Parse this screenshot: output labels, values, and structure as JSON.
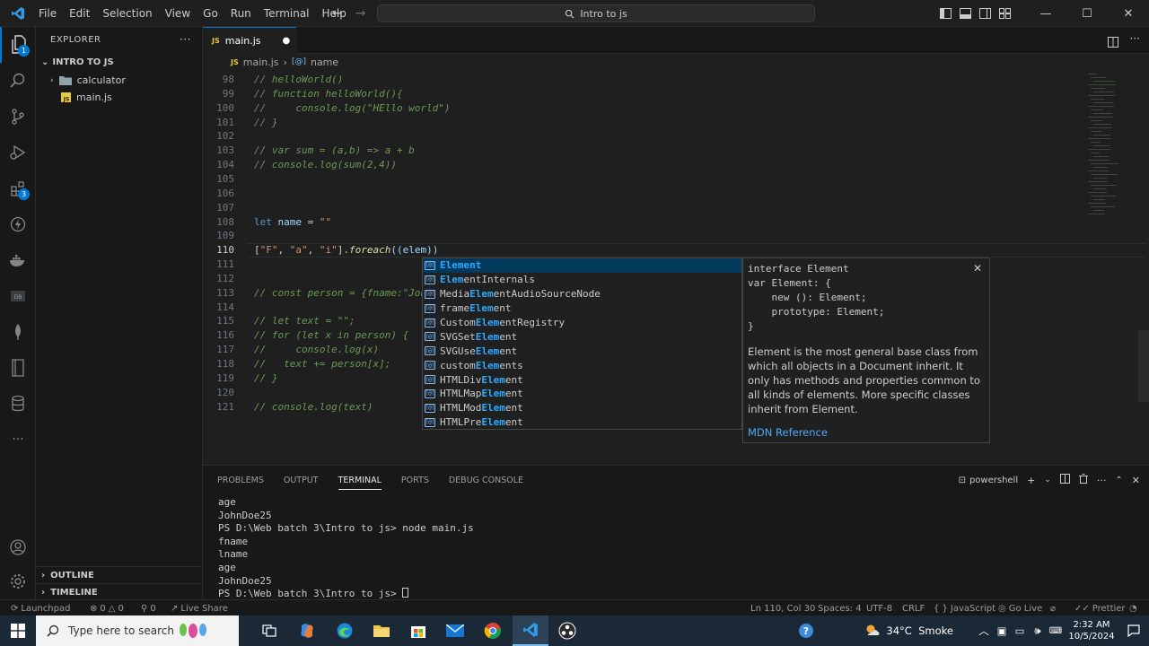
{
  "window": {
    "title": "Intro to js",
    "menu": [
      "File",
      "Edit",
      "Selection",
      "View",
      "Go",
      "Run",
      "Terminal",
      "Help"
    ]
  },
  "colors": {
    "accent": "#0078d4",
    "editor_bg": "#1f1f1f",
    "sidebar_bg": "#181818"
  },
  "sidebar": {
    "title": "EXPLORER",
    "folder": "INTRO TO JS",
    "items": [
      {
        "label": "calculator",
        "type": "folder"
      },
      {
        "label": "main.js",
        "type": "file"
      }
    ],
    "outline": "OUTLINE",
    "timeline": "TIMELINE"
  },
  "activity": {
    "explorer_badge": "1",
    "extensions_badge": "3"
  },
  "editor": {
    "tab": "main.js",
    "breadcrumb": [
      "main.js",
      "name"
    ],
    "lines": [
      {
        "n": "98",
        "text": "// helloWorld()"
      },
      {
        "n": "99",
        "text": "// function helloWorld(){"
      },
      {
        "n": "100",
        "text": "//     console.log(\"HEllo world\")"
      },
      {
        "n": "101",
        "text": "// }"
      },
      {
        "n": "102",
        "text": ""
      },
      {
        "n": "103",
        "text": "// var sum = (a,b) => a + b"
      },
      {
        "n": "104",
        "text": "// console.log(sum(2,4))"
      },
      {
        "n": "105",
        "text": ""
      },
      {
        "n": "106",
        "text": ""
      },
      {
        "n": "107",
        "text": ""
      },
      {
        "n": "108",
        "text": "let name = \"\""
      },
      {
        "n": "109",
        "text": ""
      },
      {
        "n": "110",
        "text": "[\"F\", \"a\", \"i\"].foreach((elem))"
      },
      {
        "n": "111",
        "text": ""
      },
      {
        "n": "112",
        "text": ""
      },
      {
        "n": "113",
        "text": "// const person = {fname:\"Joh"
      },
      {
        "n": "114",
        "text": ""
      },
      {
        "n": "115",
        "text": "// let text = \"\";"
      },
      {
        "n": "116",
        "text": "// for (let x in person) {"
      },
      {
        "n": "117",
        "text": "//     console.log(x)"
      },
      {
        "n": "118",
        "text": "//   text += person[x];"
      },
      {
        "n": "119",
        "text": "// }"
      },
      {
        "n": "120",
        "text": ""
      },
      {
        "n": "121",
        "text": "// console.log(text)"
      }
    ],
    "code108": {
      "kw": "let",
      "var": "name",
      "op": " = ",
      "str": "\"\""
    },
    "code110": {
      "a": "[",
      "s1": "\"F\"",
      "c1": ", ",
      "s2": "\"a\"",
      "c2": ", ",
      "s3": "\"i\"",
      "b": "].",
      "fn": "foreach",
      "rest": "((elem))"
    }
  },
  "suggest": {
    "items": [
      {
        "pre": "",
        "hl": "Element",
        "post": ""
      },
      {
        "pre": "",
        "hl": "Elem",
        "post": "entInternals"
      },
      {
        "pre": "Media",
        "hl": "Elem",
        "post": "entAudioSourceNode"
      },
      {
        "pre": "frame",
        "hl": "Elem",
        "post": "ent"
      },
      {
        "pre": "Custom",
        "hl": "Elem",
        "post": "entRegistry"
      },
      {
        "pre": "SVGSet",
        "hl": "Elem",
        "post": "ent"
      },
      {
        "pre": "SVGUse",
        "hl": "Elem",
        "post": "ent"
      },
      {
        "pre": "custom",
        "hl": "Elem",
        "post": "ents"
      },
      {
        "pre": "HTMLDiv",
        "hl": "Elem",
        "post": "ent"
      },
      {
        "pre": "HTMLMap",
        "hl": "Elem",
        "post": "ent"
      },
      {
        "pre": "HTMLMod",
        "hl": "Elem",
        "post": "ent"
      },
      {
        "pre": "HTMLPre",
        "hl": "Elem",
        "post": "ent"
      }
    ],
    "details_code": "interface Element\nvar Element: {\n    new (): Element;\n    prototype: Element;\n}",
    "details_doc": "Element is the most general base class from which all objects in a Document inherit. It only has methods and properties common to all kinds of elements. More specific classes inherit from Element.",
    "details_link": "MDN Reference"
  },
  "panel": {
    "tabs": [
      "PROBLEMS",
      "OUTPUT",
      "TERMINAL",
      "PORTS",
      "DEBUG CONSOLE"
    ],
    "active_tab": "TERMINAL",
    "shell": "powershell",
    "terminal": [
      "age",
      "JohnDoe25",
      "PS D:\\Web batch 3\\Intro to js> node main.js",
      "fname",
      "lname",
      "age",
      "JohnDoe25",
      "PS D:\\Web batch 3\\Intro to js> "
    ]
  },
  "status": {
    "launchpad": "Launchpad",
    "errors": "0",
    "warnings": "0",
    "ports": "0",
    "live_share": "Live Share",
    "position": "Ln 110, Col 30",
    "spaces": "Spaces: 4",
    "encoding": "UTF-8",
    "eol": "CRLF",
    "language": "JavaScript",
    "golive": "Go Live",
    "prettier": "Prettier"
  },
  "taskbar": {
    "search_placeholder": "Type here to search",
    "weather": "34°C  Smoke",
    "time": "2:32 AM",
    "date": "10/5/2024"
  }
}
